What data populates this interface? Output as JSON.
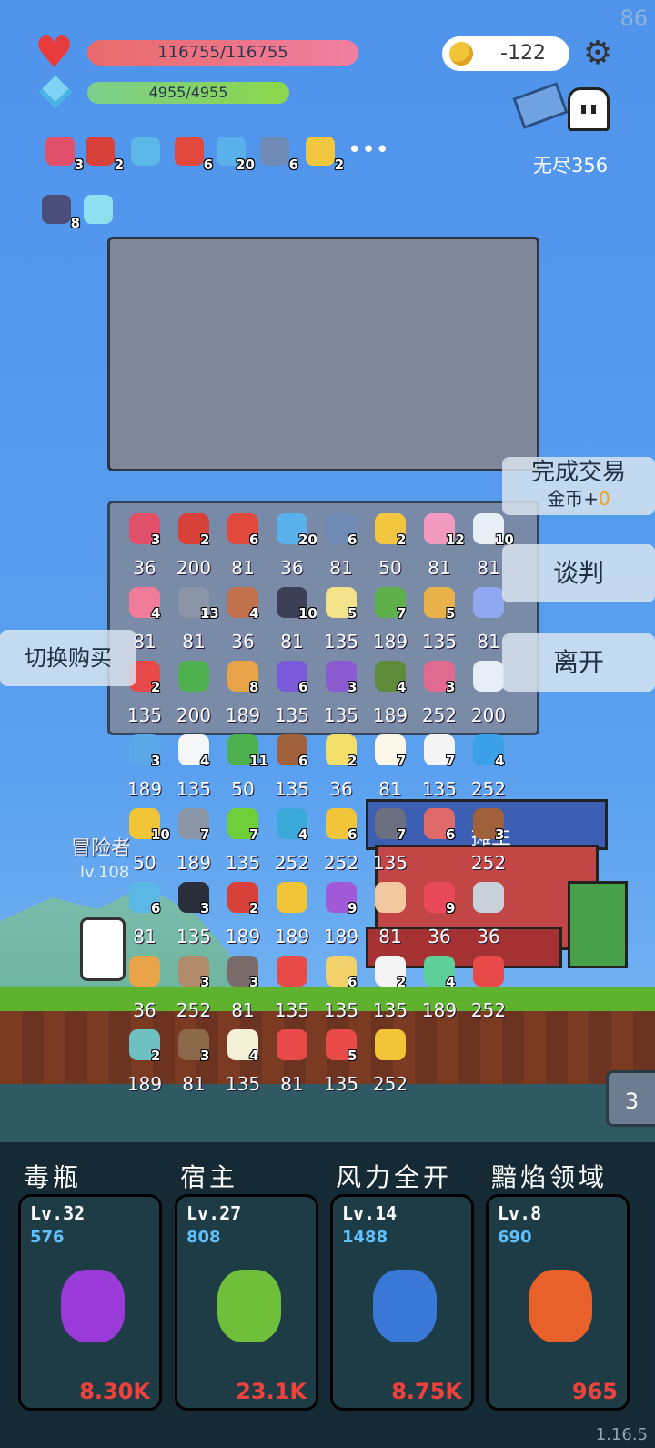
{
  "corner_number": "86",
  "version": "1.16.5",
  "hp": "116755/116755",
  "mp": "4955/4955",
  "gold": "-122",
  "endless_label": "无尽356",
  "status_items": [
    {
      "icon": "jam-jar-icon",
      "count": "3",
      "color": "#e0506a"
    },
    {
      "icon": "magnet-icon",
      "count": "2",
      "color": "#d8403a"
    },
    {
      "icon": "magnifier-icon",
      "count": "",
      "color": "#5ab7e6"
    },
    {
      "icon": "mushroom-icon",
      "count": "6",
      "color": "#e2483c"
    },
    {
      "icon": "star-card-icon",
      "count": "20",
      "color": "#5ab0ea"
    },
    {
      "icon": "shield-icon",
      "count": "6",
      "color": "#6f8ab5"
    },
    {
      "icon": "sun-icon",
      "count": "2",
      "color": "#f3c640"
    }
  ],
  "status_items_row2": [
    {
      "icon": "striped-card-icon",
      "count": "8",
      "color": "#4a4e78"
    },
    {
      "icon": "bulb-card-icon",
      "count": "",
      "color": "#8ee0f0"
    }
  ],
  "shop_items": [
    {
      "icon": "jam-jar-icon",
      "count": "3",
      "price": "36",
      "color": "#e0506a"
    },
    {
      "icon": "magnet-icon",
      "count": "2",
      "price": "200",
      "color": "#d8403a"
    },
    {
      "icon": "mushroom-icon",
      "count": "6",
      "price": "81",
      "color": "#e2483c"
    },
    {
      "icon": "star-card-icon",
      "count": "20",
      "price": "36",
      "color": "#5ab0ea"
    },
    {
      "icon": "shield-icon",
      "count": "6",
      "price": "81",
      "color": "#6f8ab5"
    },
    {
      "icon": "sun-icon",
      "count": "2",
      "price": "50",
      "color": "#f3c640"
    },
    {
      "icon": "ice-cream-icon",
      "count": "12",
      "price": "81",
      "color": "#f29ac0"
    },
    {
      "icon": "cloud-icon",
      "count": "10",
      "price": "81",
      "color": "#e8eef5"
    },
    {
      "icon": "potion-bottle-icon",
      "count": "4",
      "price": "81",
      "color": "#f07c9a"
    },
    {
      "icon": "grey-cloud-icon",
      "count": "13",
      "price": "81",
      "color": "#8a96a8"
    },
    {
      "icon": "target-disc-icon",
      "count": "4",
      "price": "36",
      "color": "#c0704a"
    },
    {
      "icon": "bat-icon",
      "count": "10",
      "price": "81",
      "color": "#3c3f55"
    },
    {
      "icon": "halo-icon",
      "count": "5",
      "price": "135",
      "color": "#f2e28a"
    },
    {
      "icon": "green-monster-icon",
      "count": "7",
      "price": "189",
      "color": "#5fb04a"
    },
    {
      "icon": "scroll-icon",
      "count": "5",
      "price": "135",
      "color": "#e9b14a"
    },
    {
      "icon": "pill-icon",
      "count": "",
      "price": "81",
      "color": "#8fa8f0"
    },
    {
      "icon": "capsule-icon",
      "count": "2",
      "price": "135",
      "color": "#e84a4a"
    },
    {
      "icon": "green-card-icon",
      "count": "",
      "price": "200",
      "color": "#4fb04f"
    },
    {
      "icon": "meteor-icon",
      "count": "8",
      "price": "189",
      "color": "#e9a44a"
    },
    {
      "icon": "treasure-box-icon",
      "count": "6",
      "price": "135",
      "color": "#7a5ad8"
    },
    {
      "icon": "purple-shield-icon",
      "count": "3",
      "price": "135",
      "color": "#8a5ad0"
    },
    {
      "icon": "grenade-icon",
      "count": "4",
      "price": "189",
      "color": "#5f8a3a"
    },
    {
      "icon": "hook-icon",
      "count": "3",
      "price": "252",
      "color": "#e06a90"
    },
    {
      "icon": "feather-icon",
      "count": "",
      "price": "200",
      "color": "#e8eef5"
    },
    {
      "icon": "chat-bubble-icon",
      "count": "3",
      "price": "189",
      "color": "#5aa8e8"
    },
    {
      "icon": "ghost-icon",
      "count": "4",
      "price": "135",
      "color": "#f4f6f8"
    },
    {
      "icon": "cash-icon",
      "count": "11",
      "price": "50",
      "color": "#4fb04f"
    },
    {
      "icon": "flag-hill-icon",
      "count": "6",
      "price": "135",
      "color": "#a0603a"
    },
    {
      "icon": "flower-icon",
      "count": "2",
      "price": "36",
      "color": "#f2e06a"
    },
    {
      "icon": "egg-icon",
      "count": "7",
      "price": "81",
      "color": "#fbf6e8"
    },
    {
      "icon": "playing-card-icon",
      "count": "7",
      "price": "135",
      "color": "#f4f4f4"
    },
    {
      "icon": "blue-gem-icon",
      "count": "4",
      "price": "252",
      "color": "#3aa0e8"
    },
    {
      "icon": "crown-icon",
      "count": "10",
      "price": "50",
      "color": "#f2c438"
    },
    {
      "icon": "compass-icon",
      "count": "7",
      "price": "189",
      "color": "#8a96a8"
    },
    {
      "icon": "lime-icon",
      "count": "7",
      "price": "135",
      "color": "#6fcf3a"
    },
    {
      "icon": "crosshair-icon",
      "count": "4",
      "price": "252",
      "color": "#3aa8d8"
    },
    {
      "icon": "magic-wand-icon",
      "count": "6",
      "price": "252",
      "color": "#f2c438"
    },
    {
      "icon": "spiked-ball-icon",
      "count": "7",
      "price": "135",
      "color": "#6a7080"
    },
    {
      "icon": "steak-icon",
      "count": "6",
      "price": "",
      "color": "#e06a6a"
    },
    {
      "icon": "bow-icon",
      "count": "3",
      "price": "252",
      "color": "#a0603a"
    },
    {
      "icon": "clock-icon",
      "count": "6",
      "price": "81",
      "color": "#5ab7e6"
    },
    {
      "icon": "cauldron-icon",
      "count": "3",
      "price": "135",
      "color": "#2a2e38"
    },
    {
      "icon": "red-shield-icon",
      "count": "2",
      "price": "189",
      "color": "#d8403a"
    },
    {
      "icon": "sunflower-icon",
      "count": "",
      "price": "189",
      "color": "#f2c438"
    },
    {
      "icon": "crystal-ball-icon",
      "count": "9",
      "price": "189",
      "color": "#a05ad8"
    },
    {
      "icon": "hand-icon",
      "count": "",
      "price": "81",
      "color": "#f2c8a0"
    },
    {
      "icon": "watermelon-icon",
      "count": "9",
      "price": "36",
      "color": "#e84a5a"
    },
    {
      "icon": "sword-icon",
      "count": "",
      "price": "36",
      "color": "#c8d0da"
    },
    {
      "icon": "book-icon",
      "count": "",
      "price": "36",
      "color": "#e9a44a"
    },
    {
      "icon": "noose-icon",
      "count": "3",
      "price": "252",
      "color": "#b08a6a"
    },
    {
      "icon": "tombstone-icon",
      "count": "3",
      "price": "81",
      "color": "#7a6a6a"
    },
    {
      "icon": "gift-icon",
      "count": "",
      "price": "135",
      "color": "#e84a4a"
    },
    {
      "icon": "note-pencil-icon",
      "count": "6",
      "price": "135",
      "color": "#f2d06a"
    },
    {
      "icon": "dice-icon",
      "count": "2",
      "price": "135",
      "color": "#f4f4f4"
    },
    {
      "icon": "jade-figure-icon",
      "count": "4",
      "price": "189",
      "color": "#5fcf9a"
    },
    {
      "icon": "hearts-icon",
      "count": "",
      "price": "252",
      "color": "#e84a4a"
    },
    {
      "icon": "disc-icon",
      "count": "2",
      "price": "189",
      "color": "#6fc0c0"
    },
    {
      "icon": "coconut-icon",
      "count": "3",
      "price": "81",
      "color": "#8a6a4a"
    },
    {
      "icon": "lightbulb-icon",
      "count": "4",
      "price": "135",
      "color": "#f4f0d8"
    },
    {
      "icon": "thermometer-icon",
      "count": "",
      "price": "81",
      "color": "#e84a4a"
    },
    {
      "icon": "bookmark-icon",
      "count": "5",
      "price": "135",
      "color": "#e84a4a"
    },
    {
      "icon": "ring-icon",
      "count": "",
      "price": "252",
      "color": "#f2c438"
    }
  ],
  "deal_button": {
    "line1": "完成交易",
    "gold_prefix": "金币+",
    "gold_value": "0"
  },
  "negotiate_label": "谈判",
  "leave_label": "离开",
  "switch_label": "切换购买",
  "adventurer_label": "冒险者",
  "adventurer_level": "lv.108",
  "shop_owner_label": "摊主",
  "side_tab": "3",
  "skills": [
    {
      "title": "毒瓶",
      "level": "Lv.32",
      "power": "576",
      "damage": "8.30K",
      "icon": "poison-flask-icon"
    },
    {
      "title": "宿主",
      "level": "Lv.27",
      "power": "808",
      "damage": "23.1K",
      "icon": "parasite-monster-icon"
    },
    {
      "title": "风力全开",
      "level": "Lv.14",
      "power": "1488",
      "damage": "8.75K",
      "icon": "blue-feather-icon"
    },
    {
      "title": "黯焰领域",
      "level": "Lv.8",
      "power": "690",
      "damage": "965",
      "icon": "campfire-icon"
    }
  ]
}
